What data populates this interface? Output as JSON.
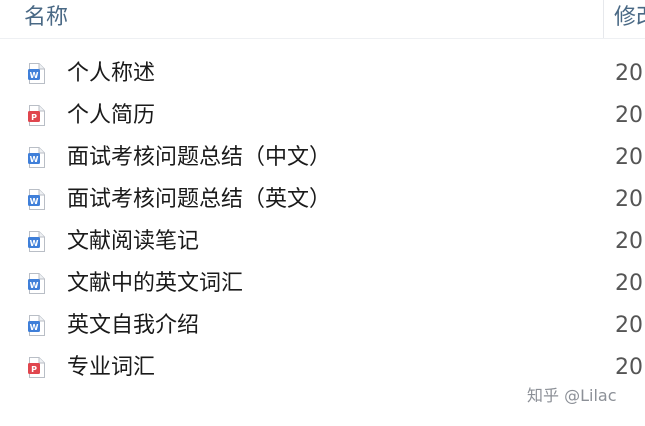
{
  "header": {
    "name_label": "名称",
    "modified_label": "修改"
  },
  "files": [
    {
      "name": "个人称述",
      "type": "word",
      "date": "20"
    },
    {
      "name": "个人简历",
      "type": "pdf",
      "date": "20"
    },
    {
      "name": "面试考核问题总结（中文）",
      "type": "word",
      "date": "20"
    },
    {
      "name": "面试考核问题总结（英文）",
      "type": "word",
      "date": "20"
    },
    {
      "name": "文献阅读笔记",
      "type": "word",
      "date": "20"
    },
    {
      "name": "文献中的英文词汇",
      "type": "word",
      "date": "20"
    },
    {
      "name": "英文自我介绍",
      "type": "word",
      "date": "20"
    },
    {
      "name": "专业词汇",
      "type": "pdf",
      "date": "20"
    }
  ],
  "icons": {
    "word": {
      "name": "word-document-icon",
      "color": "#3f7fd9",
      "letter": "W"
    },
    "pdf": {
      "name": "pdf-document-icon",
      "color": "#e0464e",
      "letter": "P"
    }
  },
  "watermark": "知乎 @Lilac"
}
